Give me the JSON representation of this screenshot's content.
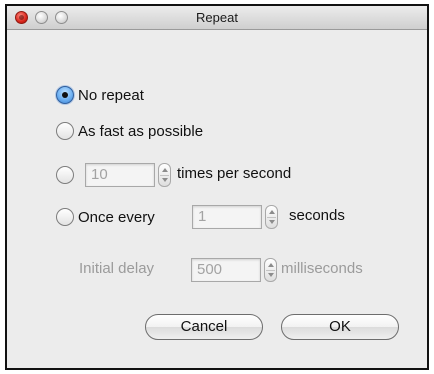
{
  "window": {
    "title": "Repeat"
  },
  "options": {
    "no_repeat": {
      "label": "No repeat",
      "selected": true
    },
    "as_fast": {
      "label": "As fast as possible",
      "selected": false
    },
    "times_per_second": {
      "value": "10",
      "label": "times per second",
      "selected": false
    },
    "once_every": {
      "label": "Once every",
      "value": "1",
      "unit": "seconds",
      "selected": false
    }
  },
  "initial_delay": {
    "label": "Initial delay",
    "value": "500",
    "unit": "milliseconds"
  },
  "buttons": {
    "cancel": "Cancel",
    "ok": "OK"
  }
}
